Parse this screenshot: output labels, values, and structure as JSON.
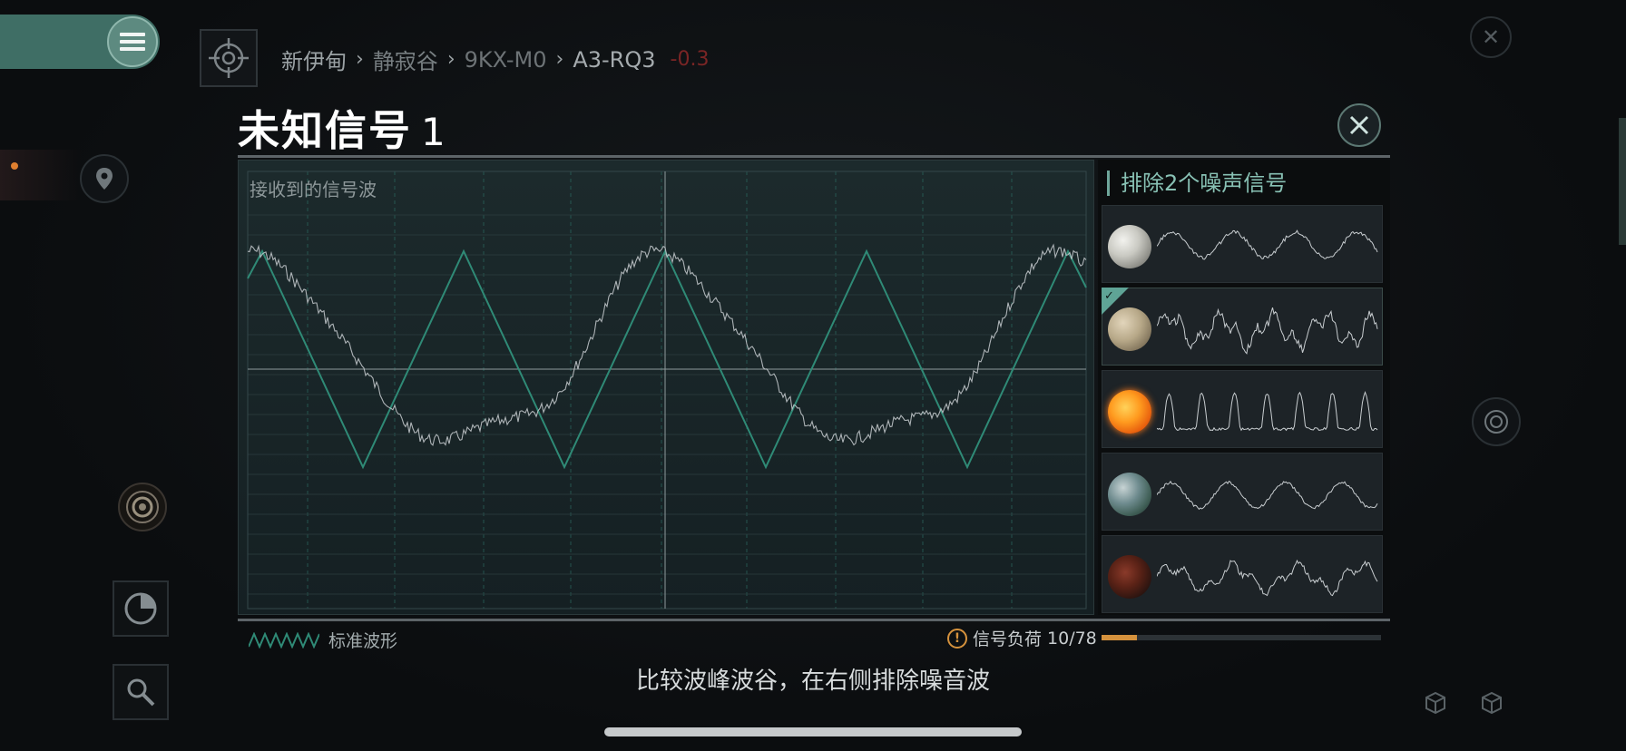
{
  "breadcrumb": {
    "items": [
      "新伊甸",
      "静寂谷",
      "9KX-M0",
      "A3-RQ3"
    ],
    "security": "-0.3"
  },
  "modal": {
    "title": "未知信号",
    "title_num": "1",
    "wave_label": "接收到的信号波"
  },
  "noise_panel": {
    "header": "排除2个噪声信号",
    "items": [
      {
        "planet": "gas-giant-icon",
        "selected": false
      },
      {
        "planet": "moon-icon",
        "selected": true
      },
      {
        "planet": "sun-icon",
        "selected": false
      },
      {
        "planet": "earth-icon",
        "selected": false
      },
      {
        "planet": "lava-planet-icon",
        "selected": false
      }
    ]
  },
  "footer": {
    "legend_label": "标准波形",
    "load_label": "信号负荷",
    "load_value": "10/78",
    "load_current": 10,
    "load_max": 78,
    "hint": "比较波峰波谷，在右侧排除噪音波"
  },
  "colors": {
    "accent": "#5fa496",
    "standard_wave": "#2f8a76",
    "signal_wave": "#c8cdd0",
    "warning": "#d5923d",
    "security": "#7a2525"
  }
}
